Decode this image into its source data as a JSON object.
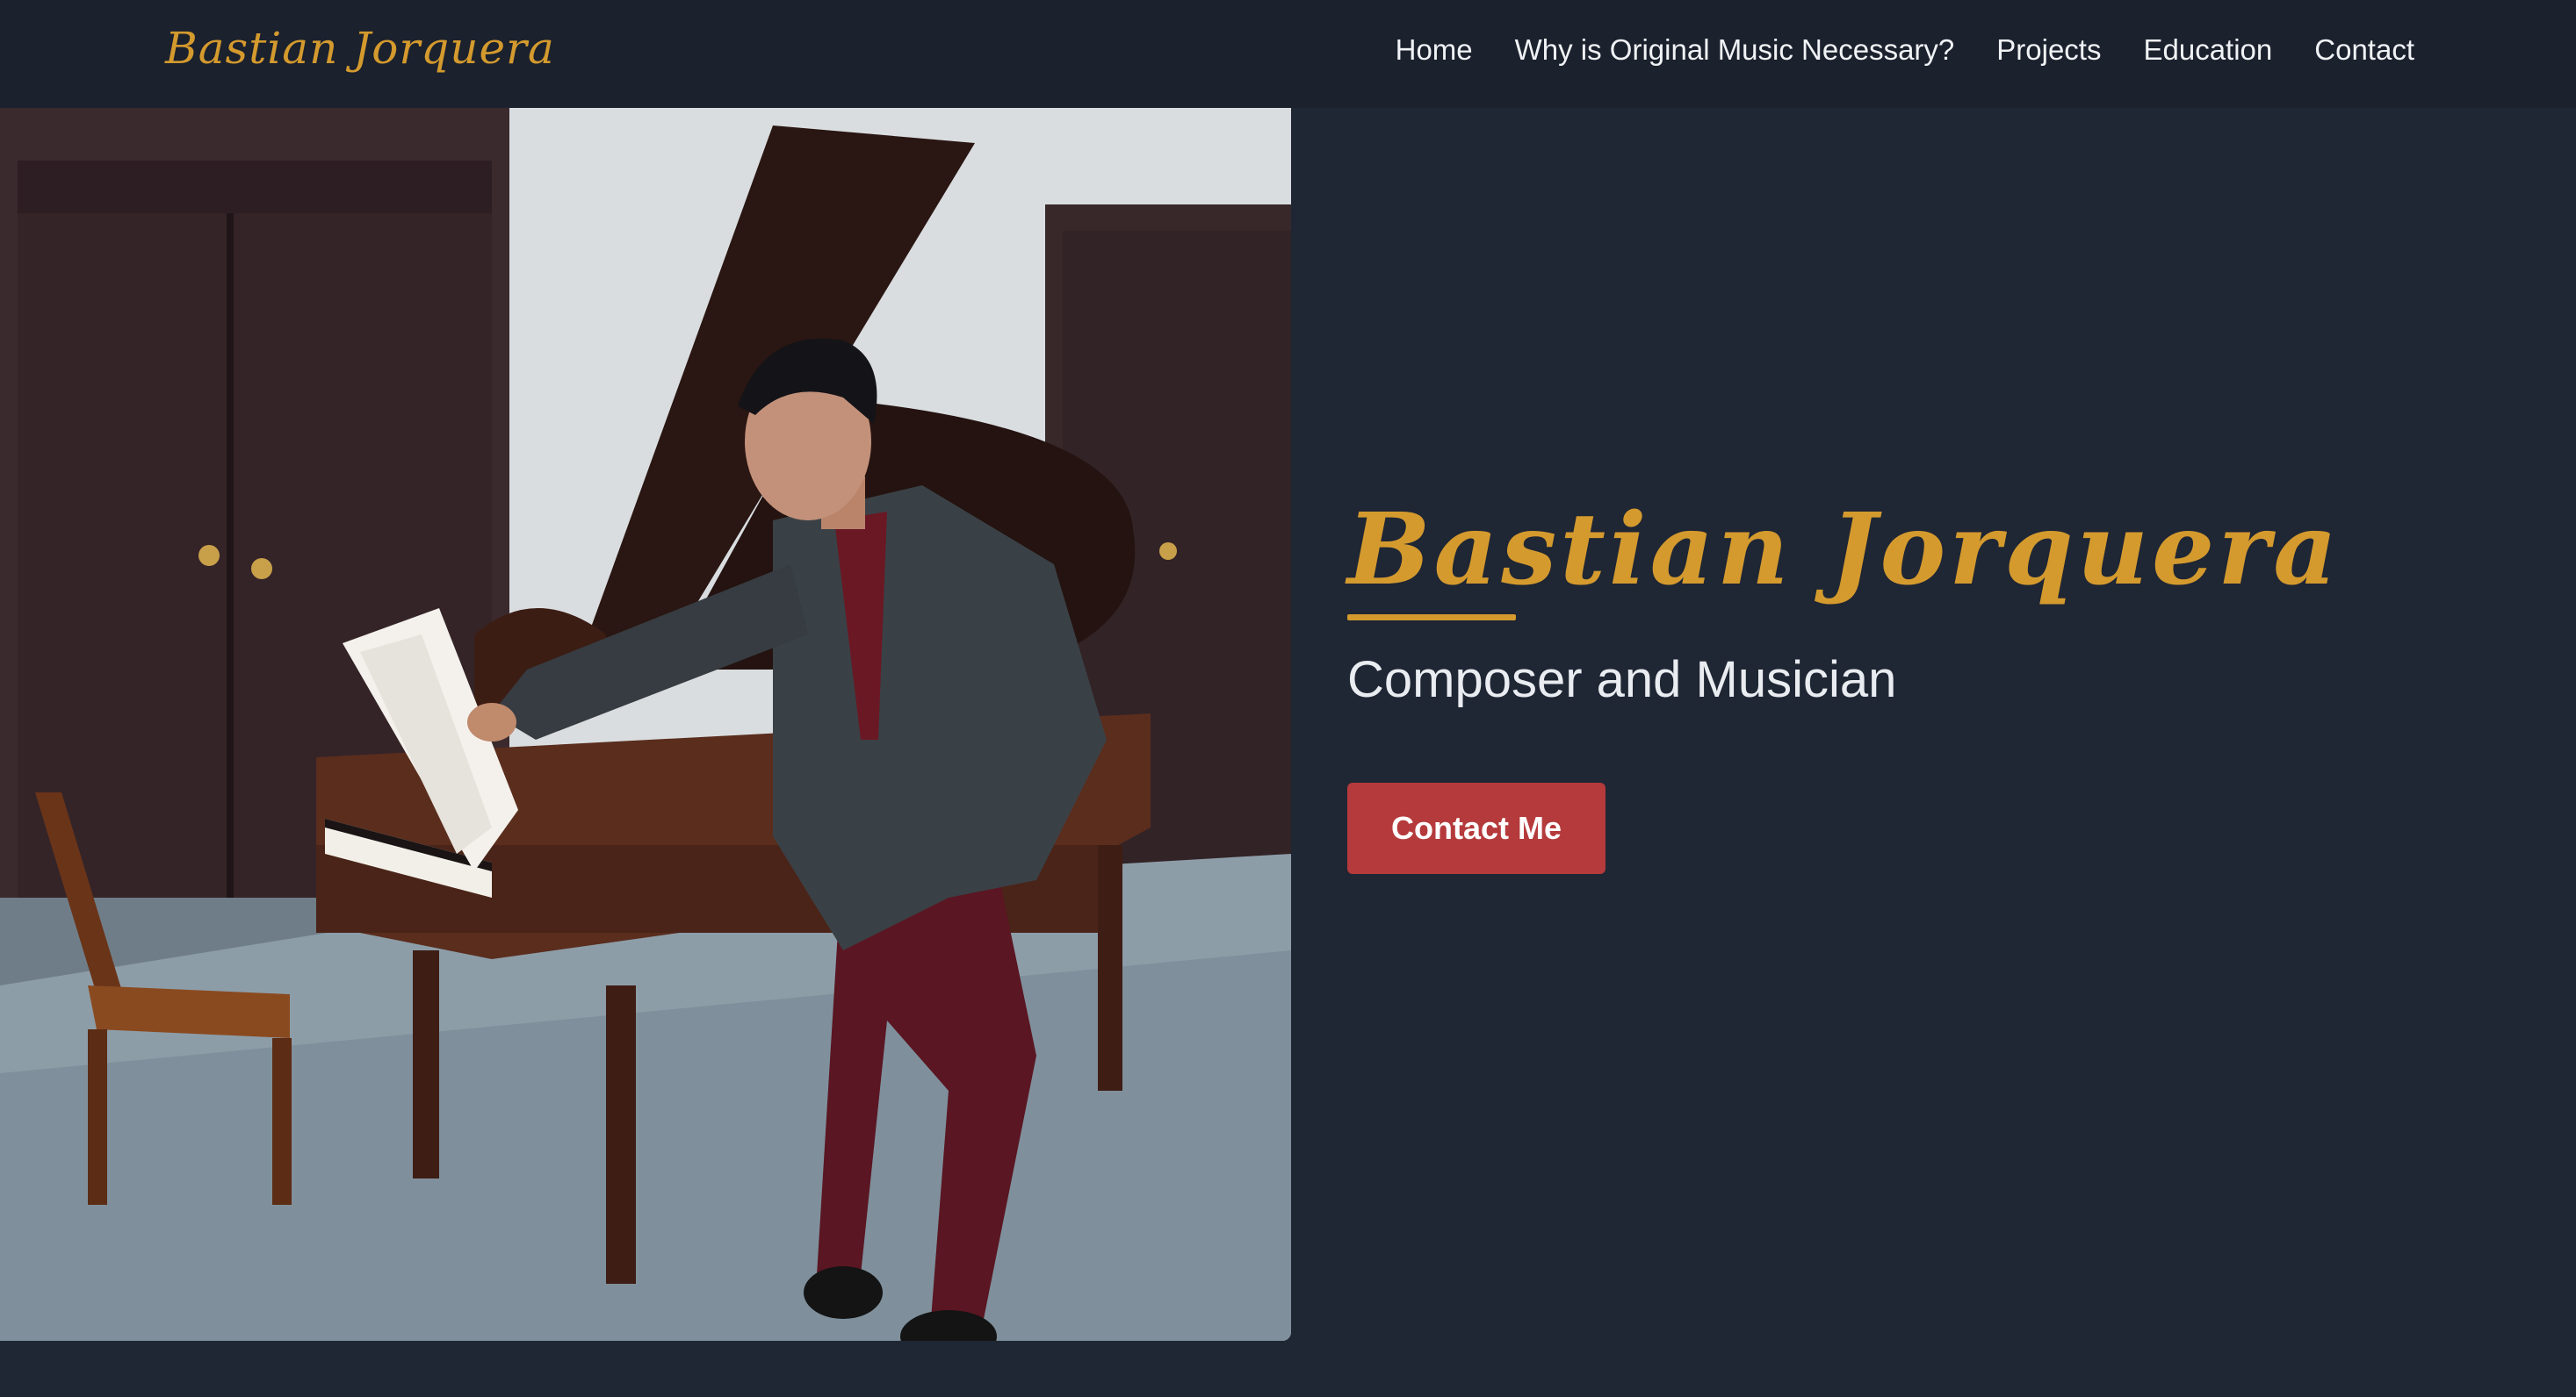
{
  "nav": {
    "brand": "Bastian Jorquera",
    "links": [
      {
        "label": "Home"
      },
      {
        "label": "Why is Original Music Necessary?"
      },
      {
        "label": "Projects"
      },
      {
        "label": "Education"
      },
      {
        "label": "Contact"
      }
    ]
  },
  "hero": {
    "title": "Bastian Jorquera",
    "subtitle": "Composer and Musician",
    "cta_label": "Contact Me"
  },
  "colors": {
    "background": "#1f2634",
    "navbar": "#1b212d",
    "accent_gold": "#d49a2e",
    "cta_red": "#b53a3c"
  }
}
